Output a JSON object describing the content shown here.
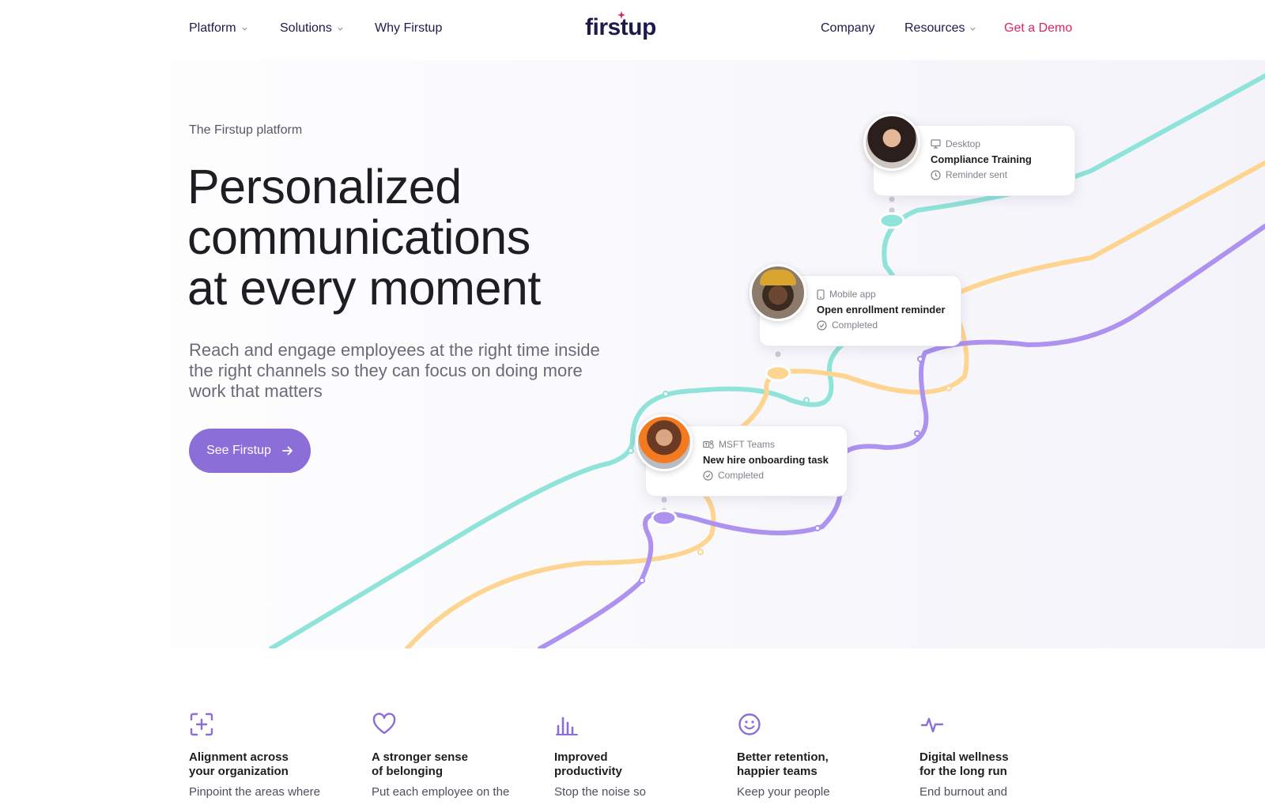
{
  "nav": {
    "left": [
      {
        "label": "Platform",
        "dropdown": true
      },
      {
        "label": "Solutions",
        "dropdown": true
      },
      {
        "label": "Why Firstup",
        "dropdown": false
      }
    ],
    "logo": "firstup",
    "right": [
      {
        "label": "Company",
        "dropdown": false
      },
      {
        "label": "Resources",
        "dropdown": true
      },
      {
        "label": "Get a Demo",
        "dropdown": false
      }
    ]
  },
  "hero": {
    "eyebrow": "The Firstup platform",
    "headline_lines": [
      "Personalized",
      "communications",
      "at every moment"
    ],
    "subtitle": "Reach and engage employees at the right time inside the right channels so they can focus on doing more work that matters",
    "cta": "See Firstup"
  },
  "cards": [
    {
      "channel": "Desktop",
      "channel_icon": "monitor-icon",
      "title": "Compliance Training",
      "status": "Reminder sent",
      "status_icon": "clock-icon"
    },
    {
      "channel": "Mobile app",
      "channel_icon": "phone-icon",
      "title": "Open enrollment reminder",
      "status": "Completed",
      "status_icon": "check-circle-icon"
    },
    {
      "channel": "MSFT Teams",
      "channel_icon": "teams-icon",
      "title": "New hire onboarding task",
      "status": "Completed",
      "status_icon": "check-circle-icon"
    }
  ],
  "features": [
    {
      "icon": "focus-plus-icon",
      "title_lines": [
        "Alignment across",
        "your organization"
      ],
      "desc": "Pinpoint the areas where"
    },
    {
      "icon": "heart-icon",
      "title_lines": [
        "A stronger sense",
        "of belonging"
      ],
      "desc": "Put each employee on the"
    },
    {
      "icon": "bar-chart-icon",
      "title_lines": [
        "Improved",
        "productivity"
      ],
      "desc": "Stop the noise so"
    },
    {
      "icon": "smiley-icon",
      "title_lines": [
        "Better retention,",
        "happier teams"
      ],
      "desc": "Keep your people"
    },
    {
      "icon": "pulse-icon",
      "title_lines": [
        "Digital wellness",
        "for the long run"
      ],
      "desc": "End burnout and"
    }
  ],
  "colors": {
    "navy": "#1e1b4b",
    "accent_purple": "#8b6ed8",
    "demo_pink": "#e0245e",
    "path_teal": "#8fe3d8",
    "path_yellow": "#fdd591",
    "path_purple": "#ad92ef"
  }
}
